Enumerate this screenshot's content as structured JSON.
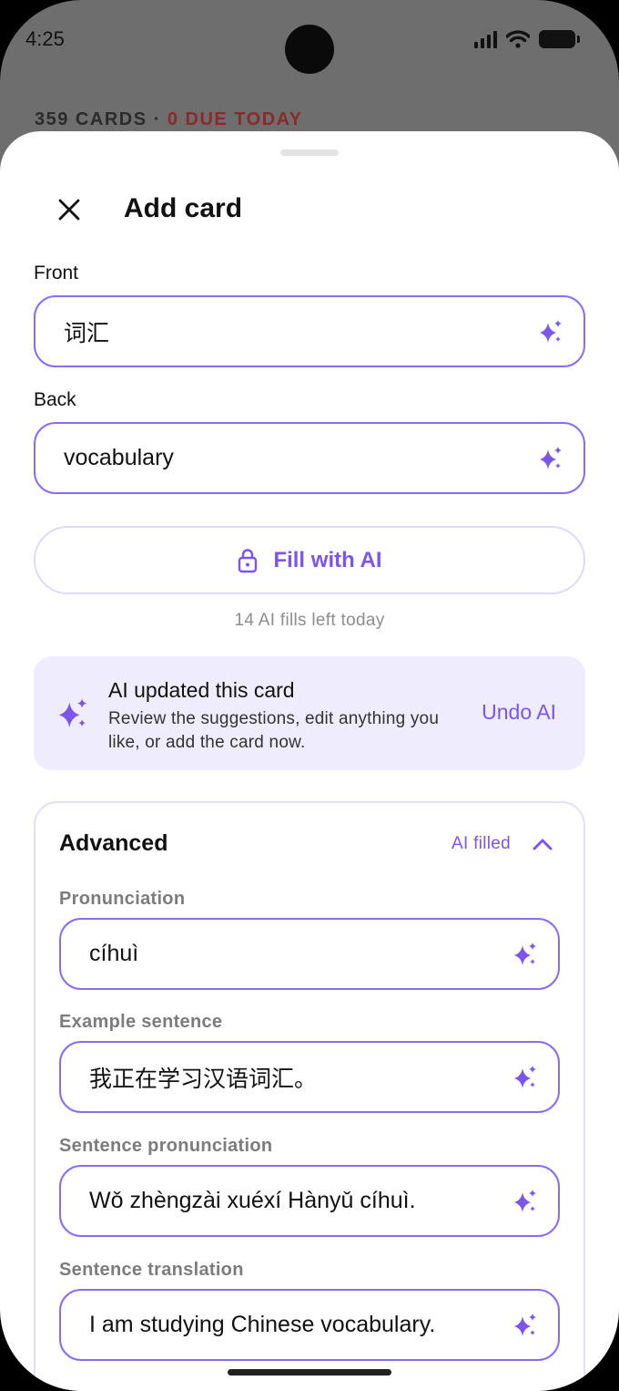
{
  "status_bar": {
    "time": "4:25"
  },
  "background": {
    "cards_count": "359 CARDS",
    "separator": " · ",
    "due_today": "0 DUE TODAY"
  },
  "header": {
    "title": "Add card"
  },
  "front": {
    "label": "Front",
    "value": "词汇"
  },
  "back": {
    "label": "Back",
    "value": "vocabulary"
  },
  "fill_button": {
    "label": "Fill with AI"
  },
  "fills_left": "14 AI fills left today",
  "ai_banner": {
    "title": "AI updated this card",
    "description": "Review the suggestions, edit anything you like, or add the card now.",
    "undo_label": "Undo AI"
  },
  "advanced": {
    "title": "Advanced",
    "status": "AI filled",
    "fields": [
      {
        "label": "Pronunciation",
        "value": "cíhuì"
      },
      {
        "label": "Example sentence",
        "value": "我正在学习汉语词汇。"
      },
      {
        "label": "Sentence pronunciation",
        "value": "Wǒ zhèngzài xuéxí Hànyǔ cíhuì."
      },
      {
        "label": "Sentence translation",
        "value": "I am studying Chinese vocabulary."
      }
    ]
  },
  "colors": {
    "accent": "#7c55ea",
    "field_border": "#8b6cf0",
    "banner_bg": "#eeecfd",
    "due": "#8a2a2a"
  }
}
